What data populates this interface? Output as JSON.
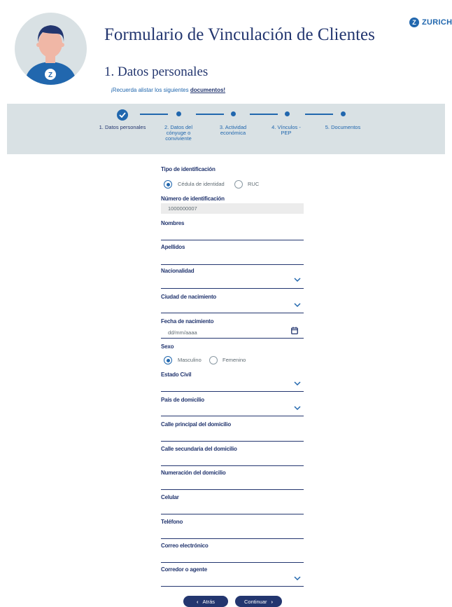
{
  "brand": {
    "name": "ZURICH",
    "logo_letter": "Z"
  },
  "header": {
    "title": "Formulario de Vinculación de Clientes",
    "section": "1. Datos personales",
    "notice_prefix": "¡Recuerda alistar los siguientes ",
    "notice_link": "documentos!"
  },
  "steps": [
    {
      "label": "1. Datos personales",
      "state": "complete"
    },
    {
      "label": "2. Datos del cónyuge o conviviente",
      "state": "pending"
    },
    {
      "label": "3. Actividad económica",
      "state": "pending"
    },
    {
      "label": "4. Vínculos - PEP",
      "state": "pending"
    },
    {
      "label": "5. Documentos",
      "state": "pending"
    }
  ],
  "form": {
    "tipo_id": {
      "label": "Tipo de identificación",
      "options": [
        "Cédula de identidad",
        "RUC"
      ],
      "selected": "Cédula de identidad"
    },
    "numero_id": {
      "label": "Número de identificación",
      "value": "1000000007"
    },
    "nombres": {
      "label": "Nombres",
      "value": ""
    },
    "apellidos": {
      "label": "Apellidos",
      "value": ""
    },
    "nacionalidad": {
      "label": "Nacionalidad",
      "value": ""
    },
    "ciudad_nacimiento": {
      "label": "Ciudad de nacimiento",
      "value": ""
    },
    "fecha_nacimiento": {
      "label": "Fecha de nacimiento",
      "placeholder": "dd/mm/aaaa"
    },
    "sexo": {
      "label": "Sexo",
      "options": [
        "Masculino",
        "Femenino"
      ],
      "selected": "Masculino"
    },
    "estado_civil": {
      "label": "Estado Civil",
      "value": ""
    },
    "pais_domicilio": {
      "label": "País de domicilio",
      "value": ""
    },
    "calle_principal": {
      "label": "Calle principal del domicilio",
      "value": ""
    },
    "calle_secundaria": {
      "label": "Calle secundaria del domicilio",
      "value": ""
    },
    "numeracion": {
      "label": "Numeración del domicilio",
      "value": ""
    },
    "celular": {
      "label": "Celular",
      "value": ""
    },
    "telefono": {
      "label": "Teléfono",
      "value": ""
    },
    "correo": {
      "label": "Correo electrónico",
      "value": ""
    },
    "corredor": {
      "label": "Corredor o agente",
      "value": ""
    }
  },
  "buttons": {
    "back": "Atrás",
    "next": "Continuar"
  },
  "colors": {
    "primary": "#23366f",
    "accent": "#2167ae",
    "panel": "#d9e1e4"
  }
}
